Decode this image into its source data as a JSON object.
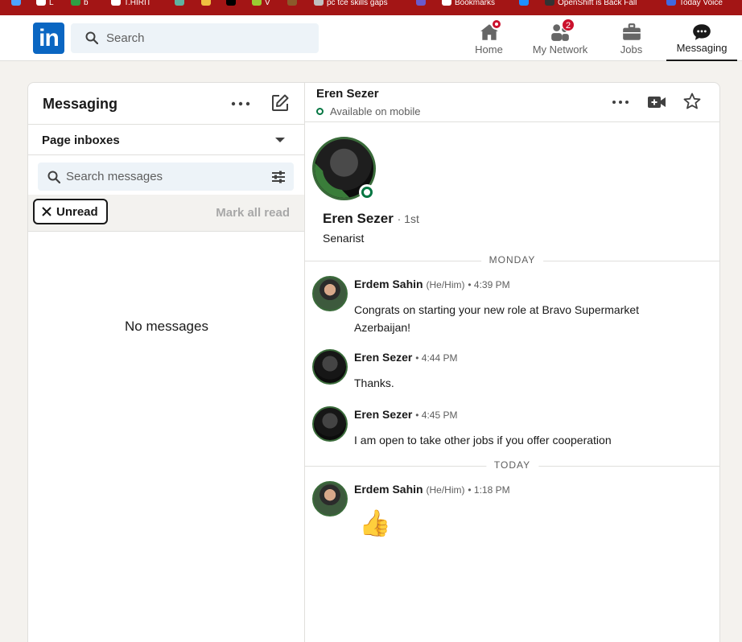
{
  "bookmarks": [
    {
      "label": "",
      "color": "#4da3ff"
    },
    {
      "label": "L",
      "color": "#ffffff"
    },
    {
      "label": "b",
      "color": "#2ea043"
    },
    {
      "label": "T.HIRIT",
      "color": "#ffffff"
    },
    {
      "label": "",
      "color": "#5fb3a0"
    },
    {
      "label": "",
      "color": "#f0c040"
    },
    {
      "label": "",
      "color": "#000000"
    },
    {
      "label": "V",
      "color": "#9acd32"
    },
    {
      "label": "",
      "color": "#8b5a2b"
    },
    {
      "label": "pc tce skills gaps",
      "color": "#c0c0c0"
    },
    {
      "label": "",
      "color": "#6a5acd"
    },
    {
      "label": "Bookmarks",
      "color": "#ffffff"
    },
    {
      "label": "",
      "color": "#1e90ff"
    },
    {
      "label": "OpenShift is Back Fall",
      "color": "#333333"
    },
    {
      "label": "Today Voice",
      "color": "#4169e1"
    }
  ],
  "nav": {
    "search_placeholder": "Search",
    "items": [
      {
        "label": "Home",
        "icon": "home-icon",
        "badge": "dot"
      },
      {
        "label": "My Network",
        "icon": "network-icon",
        "badge": "2"
      },
      {
        "label": "Jobs",
        "icon": "briefcase-icon",
        "badge": ""
      },
      {
        "label": "Messaging",
        "icon": "messaging-icon",
        "badge": "",
        "active": true
      }
    ]
  },
  "messaging": {
    "title": "Messaging",
    "inbox_label": "Page inboxes",
    "search_placeholder": "Search messages",
    "filter_chip": "Unread",
    "mark_all_read": "Mark all read",
    "empty_text": "No messages"
  },
  "conversation": {
    "name": "Eren Sezer",
    "status": "Available on mobile",
    "profile": {
      "name": "Eren Sezer",
      "degree": "· 1st",
      "headline": "Senarist"
    },
    "day_dividers": [
      "MONDAY",
      "TODAY"
    ],
    "messages": [
      {
        "sender": "Erdem Sahin",
        "pronouns": "(He/Him)",
        "time": "• 4:39 PM",
        "text": "Congrats on starting your new role at Bravo Supermarket Azerbaijan!"
      },
      {
        "sender": "Eren Sezer",
        "pronouns": "",
        "time": "• 4:44 PM",
        "text": "Thanks."
      },
      {
        "sender": "Eren Sezer",
        "pronouns": "",
        "time": "• 4:45 PM",
        "text": "I am open to take other jobs if you offer cooperation"
      },
      {
        "sender": "Erdem Sahin",
        "pronouns": "(He/Him)",
        "time": "• 1:18 PM",
        "text": "👍"
      }
    ]
  },
  "colors": {
    "brand": "#0a66c2",
    "badge": "#cb112d",
    "online": "#057642",
    "browser_bar": "#a31515"
  }
}
